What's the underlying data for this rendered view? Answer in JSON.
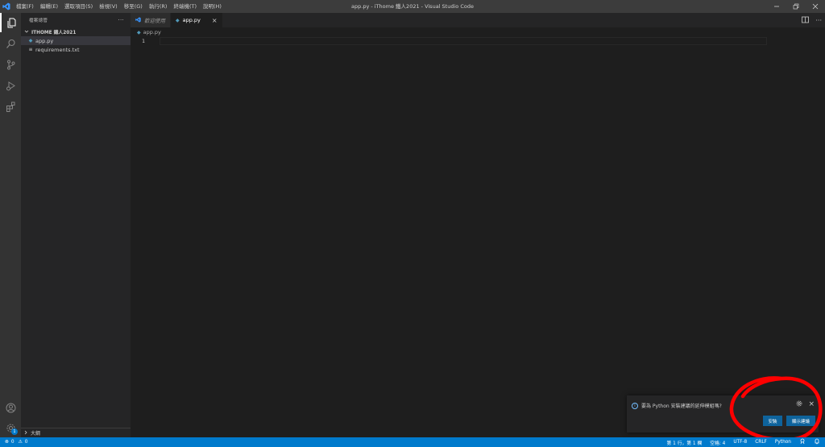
{
  "titlebar": {
    "menus": [
      "檔案(F)",
      "編輯(E)",
      "選取項目(S)",
      "檢視(V)",
      "移至(G)",
      "執行(R)",
      "終端機(T)",
      "說明(H)"
    ],
    "title": "app.py - iThome 鐵人2021 - Visual Studio Code"
  },
  "activity_bar": {
    "items": [
      "explorer-icon",
      "search-icon",
      "source-control-icon",
      "run-debug-icon",
      "extensions-icon"
    ],
    "bottom": [
      "account-icon",
      "settings-gear-icon"
    ],
    "settings_badge": "1"
  },
  "sidebar": {
    "header": "檔案總管",
    "more": "···",
    "folder": "ITHOME 鐵人2021",
    "files": [
      {
        "icon": "◆",
        "name": "app.py",
        "color": "#519aba"
      },
      {
        "icon": "≡",
        "name": "requirements.txt",
        "color": "#cccccc"
      }
    ],
    "outline": "大綱"
  },
  "tabs": [
    {
      "label": "歡迎使用",
      "italic": true,
      "icon_color": "#3794ff"
    },
    {
      "label": "app.py",
      "italic": false,
      "icon_color": "#519aba"
    }
  ],
  "tab_close": "×",
  "breadcrumb": "app.py",
  "editor": {
    "line_number": "1"
  },
  "notification": {
    "message": "要為 Python 安裝建議的延伸模組嗎?",
    "install_label": "安裝",
    "show_label": "顯示建議",
    "close": "×"
  },
  "statusbar": {
    "errors": "0",
    "warnings": "0",
    "position": "第 1 行，第 1 欄",
    "spaces": "空格: 4",
    "encoding": "UTF-8",
    "eol": "CRLF",
    "language": "Python"
  },
  "colors": {
    "accent": "#007acc",
    "annotation": "#ff0000",
    "button": "#0e639c"
  }
}
